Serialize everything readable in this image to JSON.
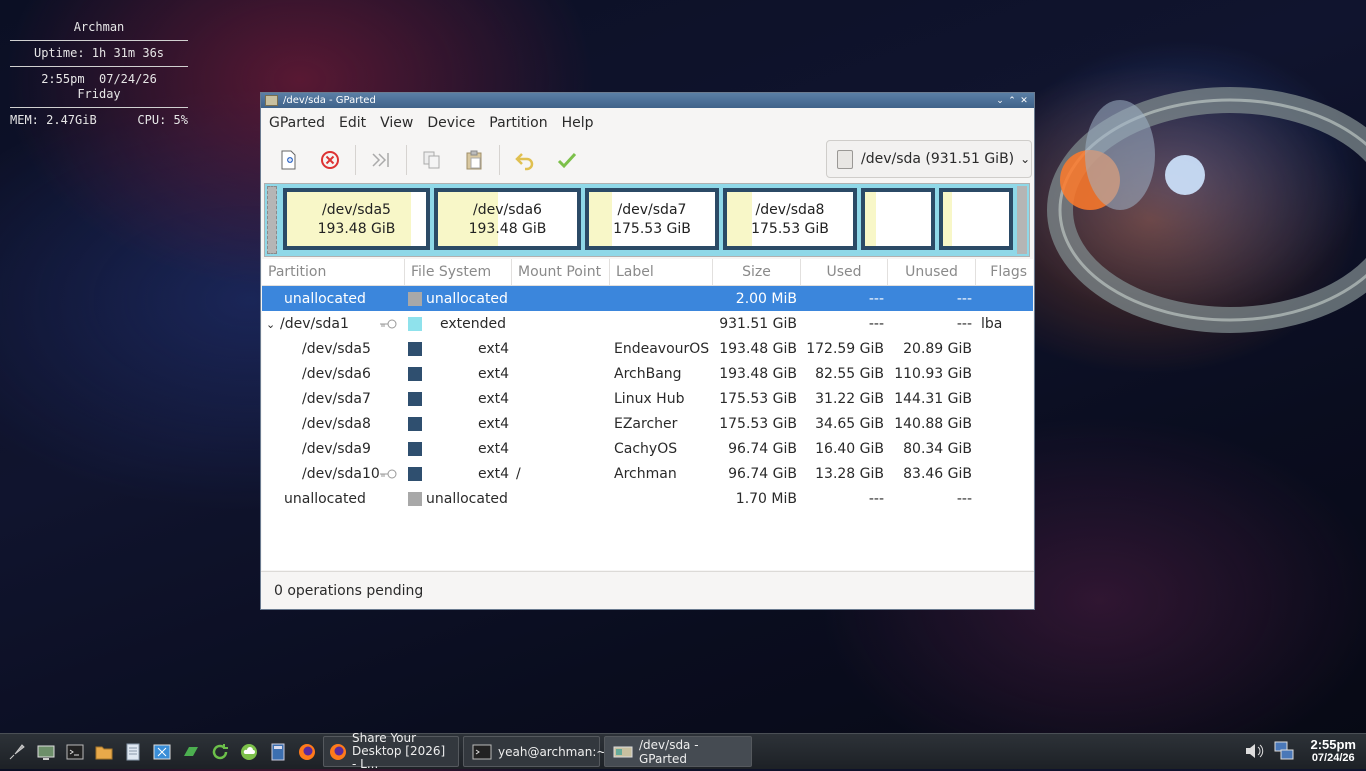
{
  "conky": {
    "host": "Archman",
    "uptime": "Uptime: 1h 31m 36s",
    "datetime": "2:55pm  07/24/26",
    "day": "Friday",
    "mem": "MEM: 2.47GiB",
    "cpu": "CPU: 5%"
  },
  "window": {
    "title": "/dev/sda - GParted",
    "menu": [
      "GParted",
      "Edit",
      "View",
      "Device",
      "Partition",
      "Help"
    ],
    "toolbar_icons": [
      "new-icon",
      "delete-icon",
      "apply-last-icon",
      "copy-icon",
      "paste-icon",
      "undo-icon",
      "apply-icon"
    ],
    "device_selector": "/dev/sda (931.51 GiB)"
  },
  "map": [
    {
      "name": "/dev/sda5",
      "size": "193.48 GiB",
      "used_fraction": 0.89
    },
    {
      "name": "/dev/sda6",
      "size": "193.48 GiB",
      "used_fraction": 0.43
    },
    {
      "name": "/dev/sda7",
      "size": "175.53 GiB",
      "used_fraction": 0.18
    },
    {
      "name": "/dev/sda8",
      "size": "175.53 GiB",
      "used_fraction": 0.2
    },
    {
      "name": "",
      "size": "",
      "used_fraction": 0.17
    },
    {
      "name": "",
      "size": "",
      "used_fraction": 0.14
    }
  ],
  "table": {
    "headers": [
      "Partition",
      "File System",
      "Mount Point",
      "Label",
      "Size",
      "Used",
      "Unused",
      "Flags"
    ],
    "rows": [
      {
        "partition": "unallocated",
        "fs": "unallocated",
        "mount": "",
        "label": "",
        "size": "2.00 MiB",
        "used": "---",
        "unused": "---",
        "flags": "",
        "color": "#a8a8a8",
        "selected": true
      },
      {
        "partition": "/dev/sda1",
        "fs": "extended",
        "mount": "",
        "label": "",
        "size": "931.51 GiB",
        "used": "---",
        "unused": "---",
        "flags": "lba",
        "color": "#8fe2ec"
      },
      {
        "partition": "/dev/sda5",
        "fs": "ext4",
        "mount": "",
        "label": "EndeavourOS",
        "size": "193.48 GiB",
        "used": "172.59 GiB",
        "unused": "20.89 GiB",
        "flags": "",
        "color": "#2f4f6f"
      },
      {
        "partition": "/dev/sda6",
        "fs": "ext4",
        "mount": "",
        "label": "ArchBang",
        "size": "193.48 GiB",
        "used": "82.55 GiB",
        "unused": "110.93 GiB",
        "flags": "",
        "color": "#2f4f6f"
      },
      {
        "partition": "/dev/sda7",
        "fs": "ext4",
        "mount": "",
        "label": "Linux Hub",
        "size": "175.53 GiB",
        "used": "31.22 GiB",
        "unused": "144.31 GiB",
        "flags": "",
        "color": "#2f4f6f"
      },
      {
        "partition": "/dev/sda8",
        "fs": "ext4",
        "mount": "",
        "label": "EZarcher",
        "size": "175.53 GiB",
        "used": "34.65 GiB",
        "unused": "140.88 GiB",
        "flags": "",
        "color": "#2f4f6f"
      },
      {
        "partition": "/dev/sda9",
        "fs": "ext4",
        "mount": "",
        "label": "CachyOS",
        "size": "96.74 GiB",
        "used": "16.40 GiB",
        "unused": "80.34 GiB",
        "flags": "",
        "color": "#2f4f6f"
      },
      {
        "partition": "/dev/sda10",
        "fs": "ext4",
        "mount": "/",
        "label": "Archman",
        "size": "96.74 GiB",
        "used": "13.28 GiB",
        "unused": "83.46 GiB",
        "flags": "",
        "color": "#2f4f6f"
      },
      {
        "partition": "unallocated",
        "fs": "unallocated",
        "mount": "",
        "label": "",
        "size": "1.70 MiB",
        "used": "---",
        "unused": "---",
        "flags": "",
        "color": "#a8a8a8"
      }
    ]
  },
  "status": "0 operations pending",
  "taskbar": {
    "tasks": [
      "Share Your Desktop [2026] - L...",
      "yeah@archman:~",
      "/dev/sda - GParted"
    ],
    "time": "2:55pm",
    "date": "07/24/26"
  }
}
